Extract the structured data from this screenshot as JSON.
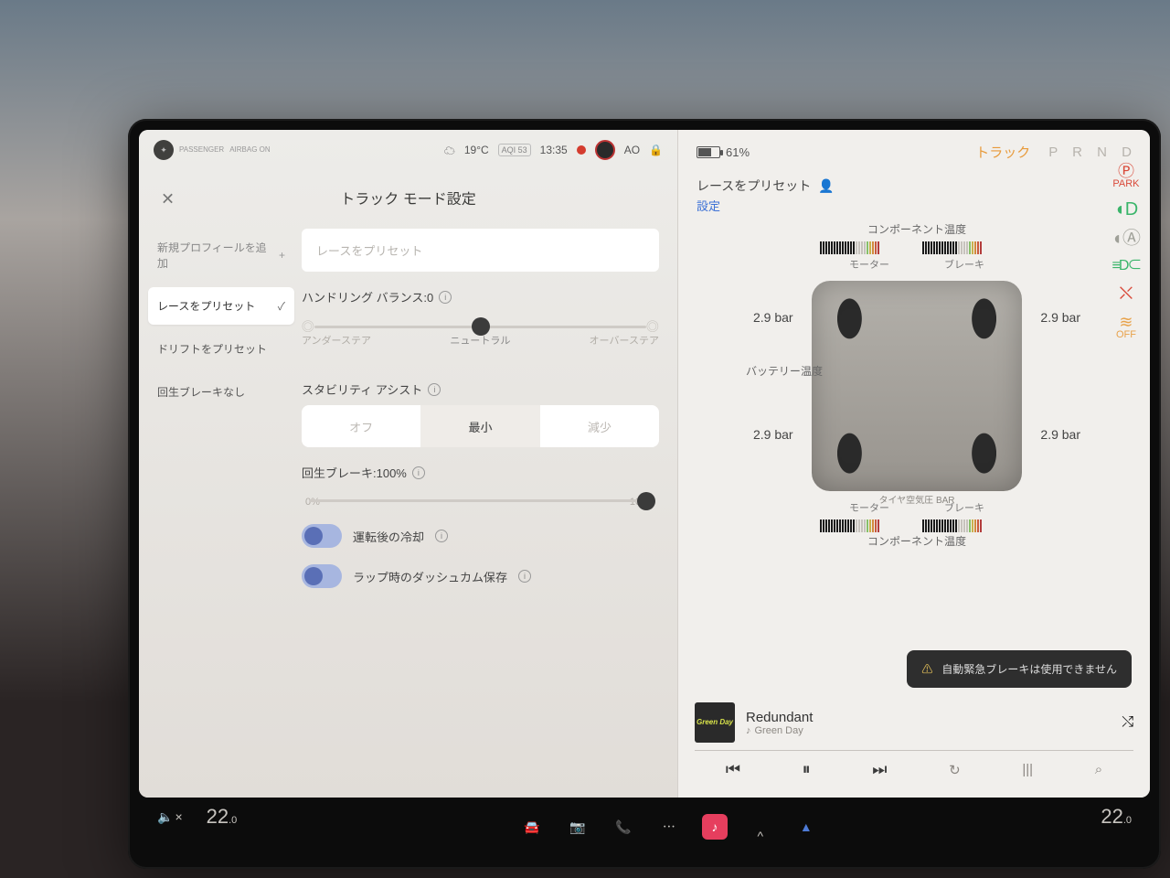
{
  "statusbar": {
    "passenger_airbag_line1": "PASSENGER",
    "passenger_airbag_line2": "AIRBAG ON",
    "weather_icon": "cloud-icon",
    "temp_outside": "19°C",
    "aqi": "AQI 53",
    "time": "13:35",
    "profile_initials": "AO"
  },
  "panel": {
    "title": "トラック モード設定",
    "close_glyph": "✕"
  },
  "profiles": {
    "add_label": "新規プロフィールを追加",
    "add_glyph": "+",
    "items": [
      {
        "label": "レースをプリセット",
        "selected": true
      },
      {
        "label": "ドリフトをプリセット",
        "selected": false
      },
      {
        "label": "回生ブレーキなし",
        "selected": false
      }
    ],
    "check_glyph": "✓"
  },
  "controls": {
    "name_placeholder": "レースをプリセット",
    "handling_label": "ハンドリング バランス:0",
    "handling_ticks": {
      "left": "アンダーステア",
      "mid": "ニュートラル",
      "right": "オーバーステア"
    },
    "handling_value_pct": 50,
    "stability_label": "スタビリティ アシスト",
    "stability_opts": {
      "off": "オフ",
      "min": "最小",
      "less": "減少"
    },
    "stability_selected": "min",
    "regen_label": "回生ブレーキ:100%",
    "regen_ticks": {
      "left": "0%",
      "right": "100%"
    },
    "postdrive_label": "運転後の冷却",
    "dashcam_label": "ラップ時のダッシュカム保存"
  },
  "right": {
    "battery_pct": "61%",
    "track_mode_label": "トラック",
    "gear_letters": "P R N D",
    "preset_name": "レースをプリセット",
    "settings_link": "設定",
    "component_temp_label": "コンポーネント温度",
    "motor_label": "モーター",
    "brake_label": "ブレーキ",
    "battery_temp_label": "バッテリー温度",
    "tire_bar_label": "タイヤ空気圧 BAR",
    "tire_pressures": {
      "fl": "2.9 bar",
      "fr": "2.9 bar",
      "rl": "2.9 bar",
      "rr": "2.9 bar"
    },
    "alert_text": "自動緊急ブレーキは使用できません"
  },
  "icons_right": {
    "park_sub": "PARK",
    "traction_sub": "OFF"
  },
  "media": {
    "album_text": "Green Day",
    "track_title": "Redundant",
    "track_artist": "Green Day",
    "prev_glyph": "⏮",
    "play_glyph": "⏸",
    "next_glyph": "⏭",
    "shuffle_glyph": "⤭",
    "repeat_glyph": "↻",
    "eq_glyph": "|||",
    "search_glyph": "⌕"
  },
  "taskbar": {
    "mute_glyph": "🔈",
    "temp_left": "22",
    "temp_sub": ".0",
    "temp_right": "22",
    "car_glyph": "🚘",
    "dashcam_glyph": "📷",
    "phone_glyph": "📞",
    "more_glyph": "⋯",
    "nav_glyph": "▲"
  }
}
